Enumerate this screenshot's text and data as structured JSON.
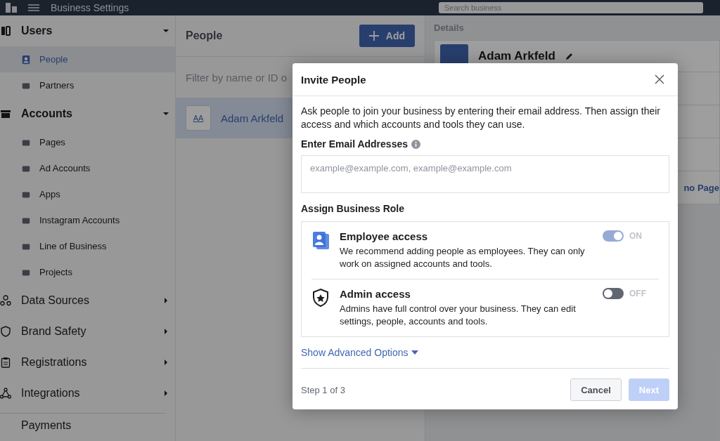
{
  "top_bar": {
    "title": "Business Settings",
    "search": {
      "placeholder": "Search business"
    }
  },
  "sidebar": {
    "groups": [
      {
        "label": "Users",
        "expanded": true,
        "items": [
          {
            "label": "People",
            "selected": true
          },
          {
            "label": "Partners",
            "selected": false
          }
        ]
      },
      {
        "label": "Accounts",
        "expanded": true,
        "items": [
          {
            "label": "Pages",
            "selected": false
          },
          {
            "label": "Ad Accounts",
            "selected": false
          },
          {
            "label": "Apps",
            "selected": false
          },
          {
            "label": "Instagram Accounts",
            "selected": false
          },
          {
            "label": "Line of Business",
            "selected": false
          },
          {
            "label": "Projects",
            "selected": false
          }
        ]
      },
      {
        "label": "Data Sources",
        "expanded": false
      },
      {
        "label": "Brand Safety",
        "expanded": false
      },
      {
        "label": "Registrations",
        "expanded": false
      },
      {
        "label": "Integrations",
        "expanded": false
      }
    ],
    "footer_item": "Payments"
  },
  "people_panel": {
    "title": "People",
    "add_button": "Add",
    "filter": {
      "placeholder": "Filter by name or ID o"
    },
    "rows": [
      {
        "initials": "AA",
        "name": "Adam Arkfeld",
        "selected": true
      }
    ]
  },
  "details": {
    "title": "Details",
    "name": "Adam Arkfeld",
    "link": "no Page"
  },
  "modal": {
    "title": "Invite People",
    "description": "Ask people to join your business by entering their email address. Then assign their access and which accounts and tools they can use.",
    "email_label": "Enter Email Addresses",
    "email_field": {
      "placeholder": "example@example.com, example@example.com"
    },
    "role_label": "Assign Business Role",
    "roles": [
      {
        "title": "Employee access",
        "description": "We recommend adding people as employees. They can only work on assigned accounts and tools.",
        "on": true,
        "disabled": true,
        "state_label": "ON"
      },
      {
        "title": "Admin access",
        "description": "Admins have full control over your business. They can edit settings, people, accounts and tools.",
        "on": false,
        "disabled": false,
        "state_label": "OFF"
      }
    ],
    "advanced_link": "Show Advanced Options",
    "step": "Step 1 of 3",
    "buttons": {
      "cancel": "Cancel",
      "next": {
        "label": "Next",
        "disabled": true
      }
    }
  }
}
